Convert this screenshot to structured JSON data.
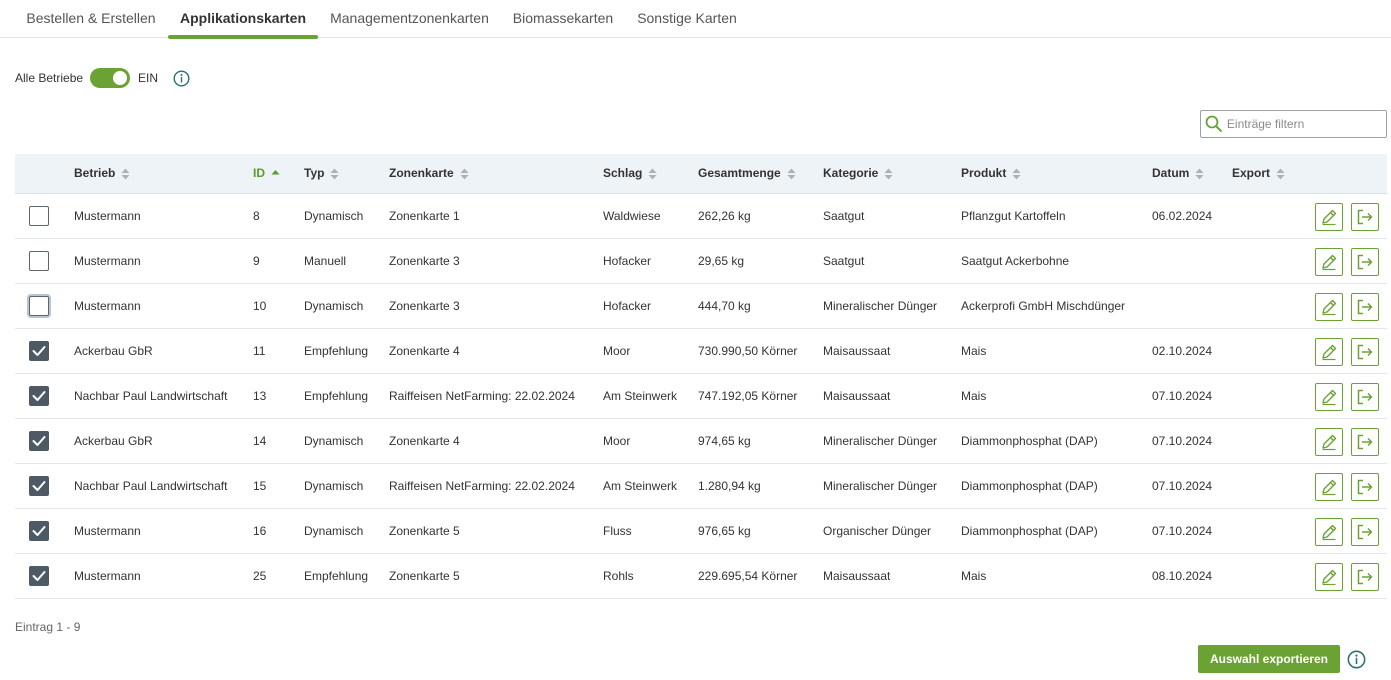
{
  "tabs": [
    {
      "label": "Bestellen & Erstellen"
    },
    {
      "label": "Applikationskarten"
    },
    {
      "label": "Managementzonenkarten"
    },
    {
      "label": "Biomassekarten"
    },
    {
      "label": "Sonstige Karten"
    }
  ],
  "toggle": {
    "label": "Alle Betriebe",
    "state": "EIN"
  },
  "filter": {
    "placeholder": "Einträge filtern"
  },
  "table": {
    "columns": [
      "Betrieb",
      "ID",
      "Typ",
      "Zonenkarte",
      "Schlag",
      "Gesamtmenge",
      "Kategorie",
      "Produkt",
      "Datum",
      "Export"
    ],
    "rows": [
      {
        "betrieb": "Mustermann",
        "id": "8",
        "typ": "Dynamisch",
        "zonenkarte": "Zonenkarte 1",
        "schlag": "Waldwiese",
        "gesamtmenge": "262,26 kg",
        "kategorie": "Saatgut",
        "produkt": "Pflanzgut Kartoffeln",
        "datum": "06.02.2024"
      },
      {
        "betrieb": "Mustermann",
        "id": "9",
        "typ": "Manuell",
        "zonenkarte": "Zonenkarte 3",
        "schlag": "Hofacker",
        "gesamtmenge": "29,65 kg",
        "kategorie": "Saatgut",
        "produkt": "Saatgut Ackerbohne",
        "datum": ""
      },
      {
        "betrieb": "Mustermann",
        "id": "10",
        "typ": "Dynamisch",
        "zonenkarte": "Zonenkarte 3",
        "schlag": "Hofacker",
        "gesamtmenge": "444,70 kg",
        "kategorie": "Mineralischer Dünger",
        "produkt": "Ackerprofi GmbH Mischdünger",
        "datum": ""
      },
      {
        "betrieb": "Ackerbau GbR",
        "id": "11",
        "typ": "Empfehlung",
        "zonenkarte": "Zonenkarte 4",
        "schlag": "Moor",
        "gesamtmenge": "730.990,50 Körner",
        "kategorie": "Maisaussaat",
        "produkt": "Mais",
        "datum": "02.10.2024"
      },
      {
        "betrieb": "Nachbar Paul Landwirtschaft",
        "id": "13",
        "typ": "Empfehlung",
        "zonenkarte": "Raiffeisen NetFarming: 22.02.2024",
        "schlag": "Am Steinwerk",
        "gesamtmenge": "747.192,05 Körner",
        "kategorie": "Maisaussaat",
        "produkt": "Mais",
        "datum": "07.10.2024"
      },
      {
        "betrieb": "Ackerbau GbR",
        "id": "14",
        "typ": "Dynamisch",
        "zonenkarte": "Zonenkarte 4",
        "schlag": "Moor",
        "gesamtmenge": "974,65 kg",
        "kategorie": "Mineralischer Dünger",
        "produkt": "Diammonphosphat (DAP)",
        "datum": "07.10.2024"
      },
      {
        "betrieb": "Nachbar Paul Landwirtschaft",
        "id": "15",
        "typ": "Dynamisch",
        "zonenkarte": "Raiffeisen NetFarming: 22.02.2024",
        "schlag": "Am Steinwerk",
        "gesamtmenge": "1.280,94 kg",
        "kategorie": "Mineralischer Dünger",
        "produkt": "Diammonphosphat (DAP)",
        "datum": "07.10.2024"
      },
      {
        "betrieb": "Mustermann",
        "id": "16",
        "typ": "Dynamisch",
        "zonenkarte": "Zonenkarte 5",
        "schlag": "Fluss",
        "gesamtmenge": "976,65 kg",
        "kategorie": "Organischer Dünger",
        "produkt": "Diammonphosphat (DAP)",
        "datum": "07.10.2024"
      },
      {
        "betrieb": "Mustermann",
        "id": "25",
        "typ": "Empfehlung",
        "zonenkarte": "Zonenkarte 5",
        "schlag": "Rohls",
        "gesamtmenge": "229.695,54 Körner",
        "kategorie": "Maisaussaat",
        "produkt": "Mais",
        "datum": "08.10.2024"
      }
    ]
  },
  "footer": {
    "entries": "Eintrag 1 - 9",
    "export_button": "Auswahl exportieren"
  },
  "colors": {
    "accent": "#6aa334",
    "checkbox_checked": "#4d5a66",
    "header_bg": "#eef3f8"
  },
  "icons": [
    "info-icon",
    "search-icon",
    "sort-icon",
    "sort-asc-icon",
    "checkmark-icon",
    "edit-pencil-icon",
    "export-icon"
  ]
}
